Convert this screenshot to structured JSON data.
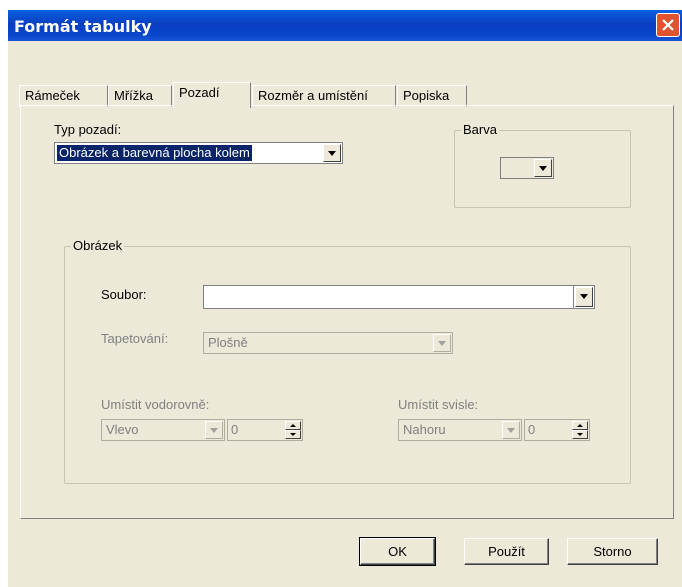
{
  "window": {
    "title": "Formát tabulky"
  },
  "tabs": [
    {
      "label": "Rámeček"
    },
    {
      "label": "Mřížka"
    },
    {
      "label": "Pozadí"
    },
    {
      "label": "Rozměr a umístění"
    },
    {
      "label": "Popiska"
    }
  ],
  "active_tab": "Pozadí",
  "background": {
    "type_label": "Typ pozadí:",
    "type_value": "Obrázek a barevná plocha kolem"
  },
  "color_group": {
    "legend": "Barva"
  },
  "image_group": {
    "legend": "Obrázek",
    "file_label": "Soubor:",
    "file_value": "",
    "tiling_label": "Tapetování:",
    "tiling_value": "Plošně",
    "horizontal_label": "Umístit vodorovně:",
    "horizontal_value": "Vlevo",
    "horizontal_offset": "0",
    "vertical_label": "Umístit svisle:",
    "vertical_value": "Nahoru",
    "vertical_offset": "0"
  },
  "buttons": {
    "ok": "OK",
    "apply": "Použít",
    "cancel": "Storno"
  },
  "colors": {
    "titlebar": "#0a46c9",
    "dialog_bg": "#ece9d8",
    "selection": "#0a246a",
    "close_button": "#e0532f"
  }
}
